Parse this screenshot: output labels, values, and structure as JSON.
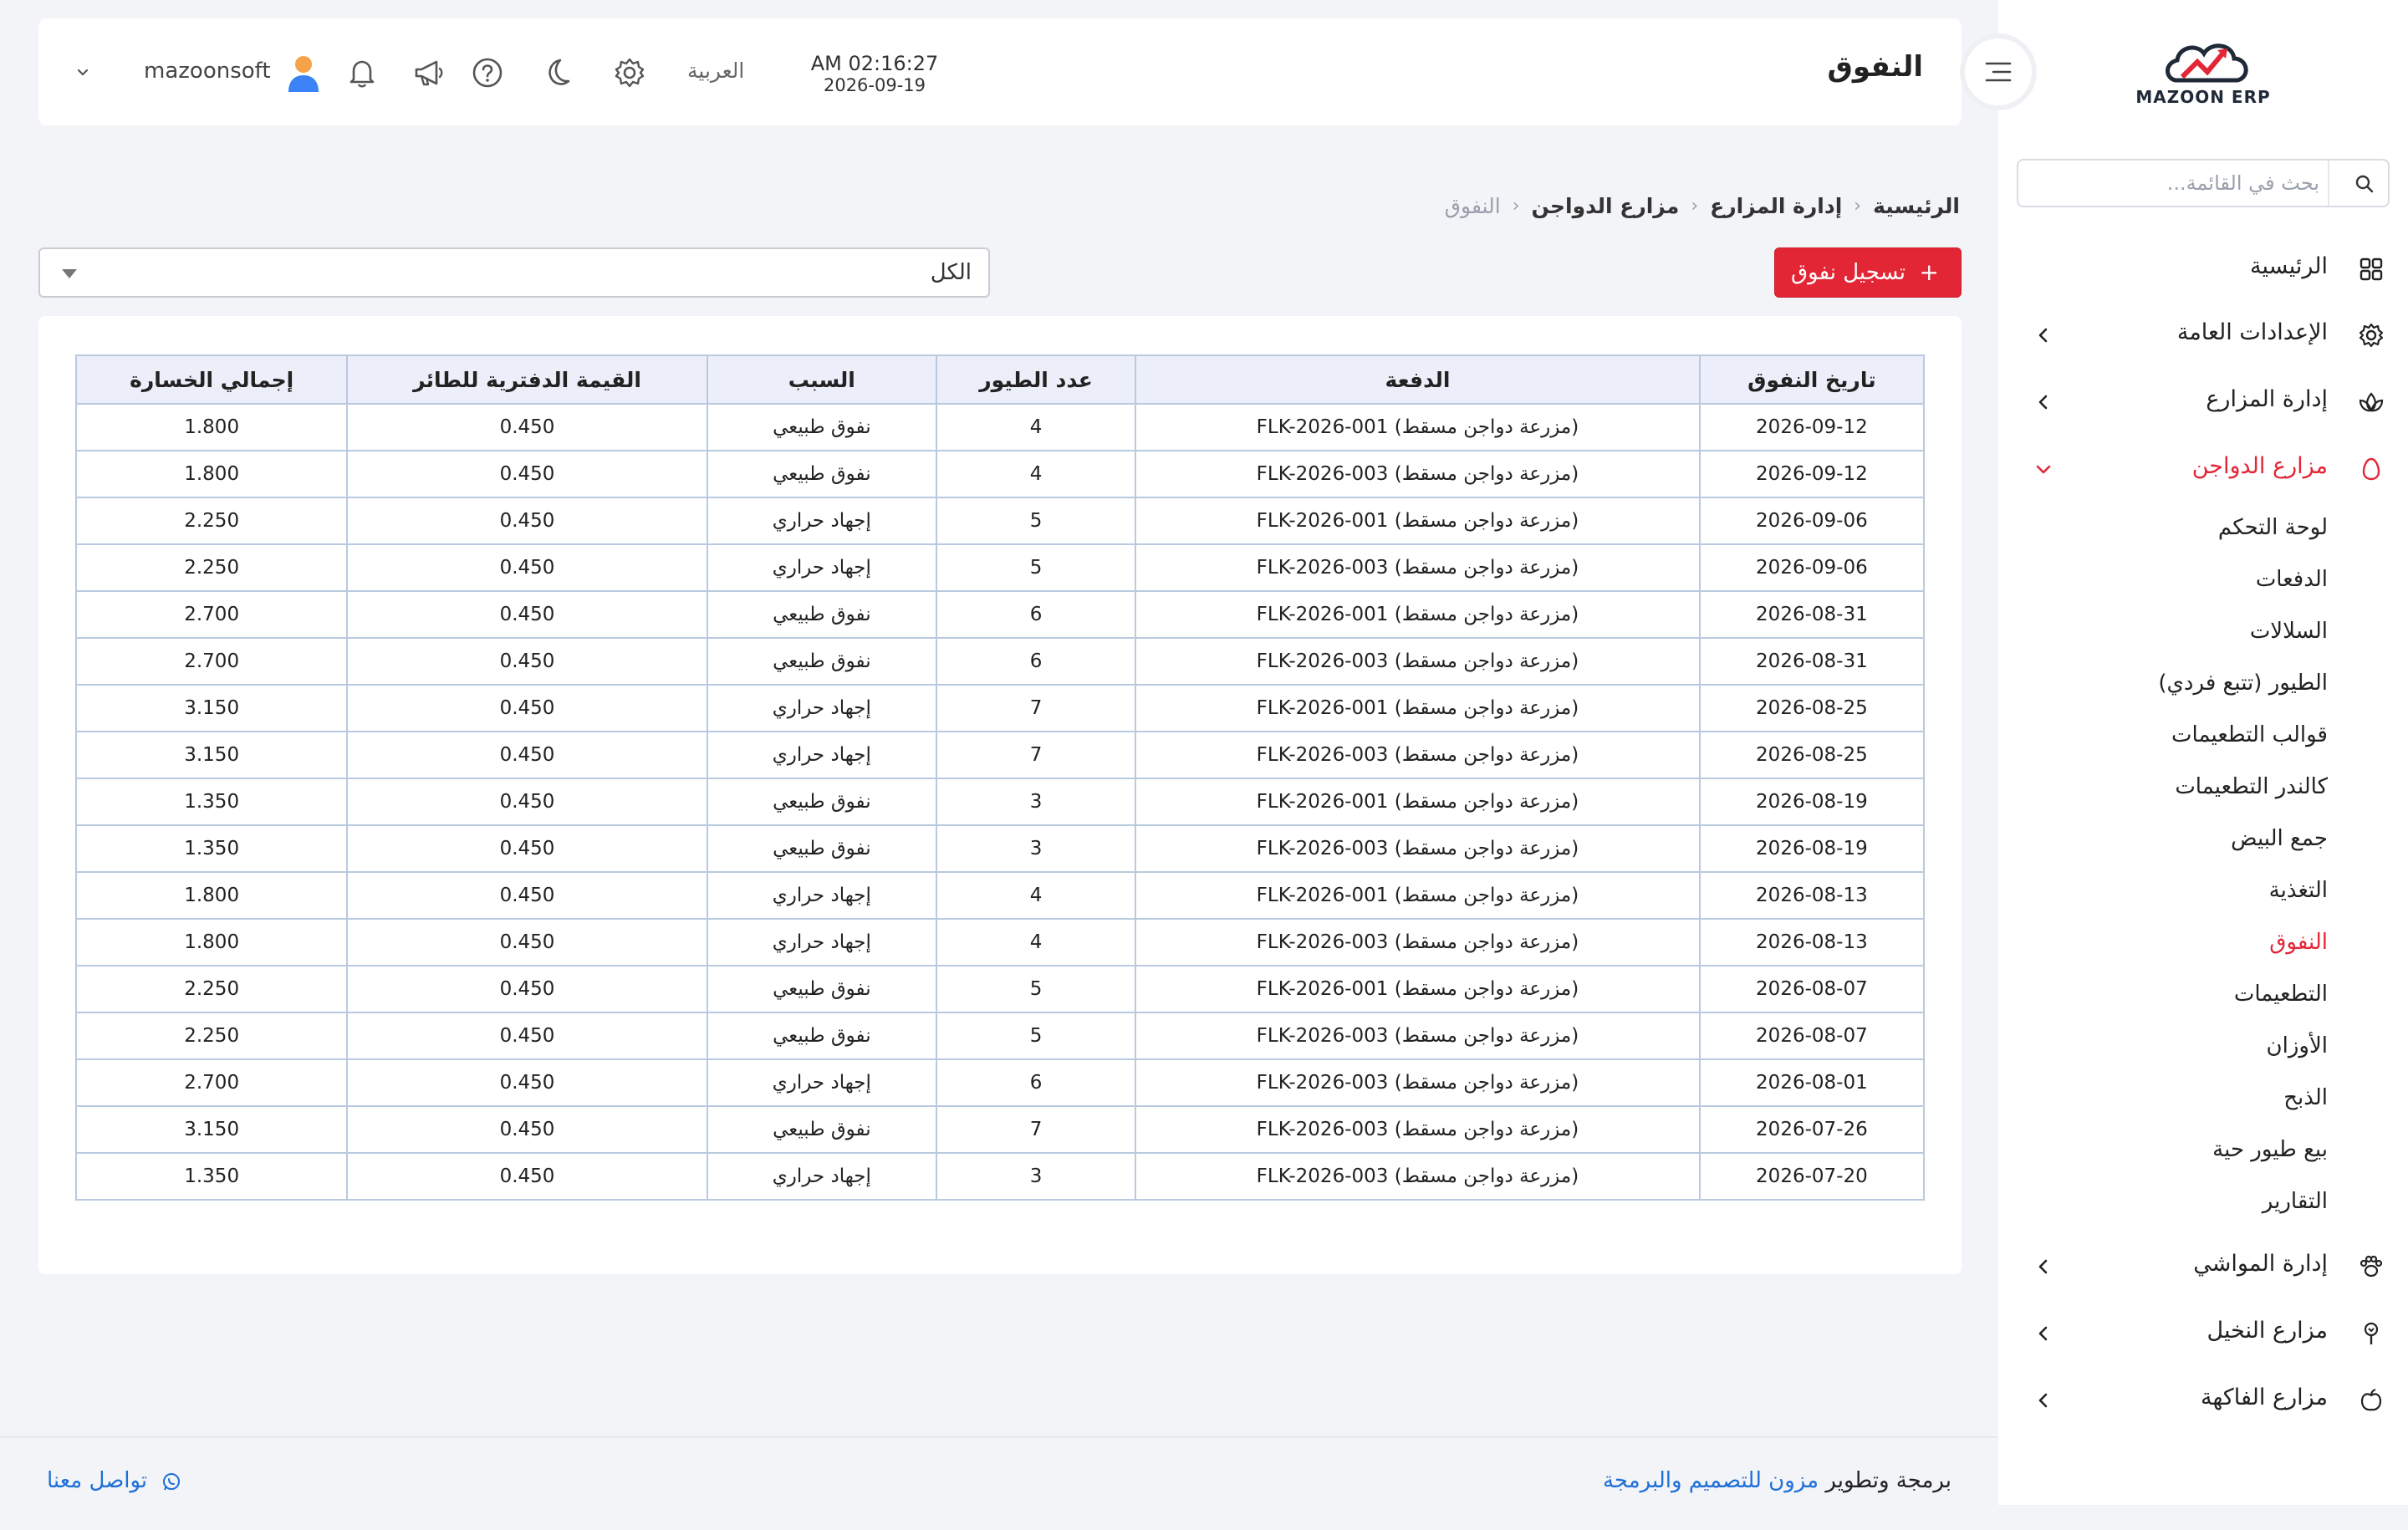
{
  "sidebar": {
    "logo_text": "MAZOON ERP",
    "search_placeholder": "بحث في القائمة...",
    "items": [
      {
        "label": "الرئيسية",
        "icon": "grid-icon"
      },
      {
        "label": "الإعدادات العامة",
        "icon": "gear-icon"
      },
      {
        "label": "إدارة المزارع",
        "icon": "plant-icon"
      },
      {
        "label": "مزارع الدواجن",
        "icon": "egg-icon"
      },
      {
        "label": "إدارة المواشي",
        "icon": "paw-icon"
      },
      {
        "label": "مزارع النخيل",
        "icon": "palm-icon"
      },
      {
        "label": "مزارع الفاكهة",
        "icon": "apple-icon"
      }
    ],
    "sub_items": [
      "لوحة التحكم",
      "الدفعات",
      "السلالات",
      "الطيور (تتبع فردي)",
      "قوالب التطعيمات",
      "كالندر التطعيمات",
      "جمع البيض",
      "التغذية",
      "النفوق",
      "التطعيمات",
      "الأوزان",
      "الذبح",
      "بيع طيور حية",
      "التقارير"
    ]
  },
  "header": {
    "title": "النفوق",
    "time": "AM 02:16:27",
    "date": "2026-09-19",
    "language": "العربية",
    "username": "mazoonsoft"
  },
  "breadcrumb": [
    "الرئيسية",
    "إدارة المزارع",
    "مزارع الدواجن",
    "النفوق"
  ],
  "toolbar": {
    "add_label": "تسجيل نفوق",
    "add_icon": "+",
    "filter_value": "الكل"
  },
  "table": {
    "headers": [
      "تاريخ النفوق",
      "الدفعة",
      "عدد الطيور",
      "السبب",
      "القيمة الدفترية للطائر",
      "إجمالي الخسارة"
    ],
    "rows": [
      [
        "2026-09-12",
        "FLK-2026-001 (مزرعة دواجن مسقط)",
        "4",
        "نفوق طبيعي",
        "0.450",
        "1.800"
      ],
      [
        "2026-09-12",
        "FLK-2026-003 (مزرعة دواجن مسقط)",
        "4",
        "نفوق طبيعي",
        "0.450",
        "1.800"
      ],
      [
        "2026-09-06",
        "FLK-2026-001 (مزرعة دواجن مسقط)",
        "5",
        "إجهاد حراري",
        "0.450",
        "2.250"
      ],
      [
        "2026-09-06",
        "FLK-2026-003 (مزرعة دواجن مسقط)",
        "5",
        "إجهاد حراري",
        "0.450",
        "2.250"
      ],
      [
        "2026-08-31",
        "FLK-2026-001 (مزرعة دواجن مسقط)",
        "6",
        "نفوق طبيعي",
        "0.450",
        "2.700"
      ],
      [
        "2026-08-31",
        "FLK-2026-003 (مزرعة دواجن مسقط)",
        "6",
        "نفوق طبيعي",
        "0.450",
        "2.700"
      ],
      [
        "2026-08-25",
        "FLK-2026-001 (مزرعة دواجن مسقط)",
        "7",
        "إجهاد حراري",
        "0.450",
        "3.150"
      ],
      [
        "2026-08-25",
        "FLK-2026-003 (مزرعة دواجن مسقط)",
        "7",
        "إجهاد حراري",
        "0.450",
        "3.150"
      ],
      [
        "2026-08-19",
        "FLK-2026-001 (مزرعة دواجن مسقط)",
        "3",
        "نفوق طبيعي",
        "0.450",
        "1.350"
      ],
      [
        "2026-08-19",
        "FLK-2026-003 (مزرعة دواجن مسقط)",
        "3",
        "نفوق طبيعي",
        "0.450",
        "1.350"
      ],
      [
        "2026-08-13",
        "FLK-2026-001 (مزرعة دواجن مسقط)",
        "4",
        "إجهاد حراري",
        "0.450",
        "1.800"
      ],
      [
        "2026-08-13",
        "FLK-2026-003 (مزرعة دواجن مسقط)",
        "4",
        "إجهاد حراري",
        "0.450",
        "1.800"
      ],
      [
        "2026-08-07",
        "FLK-2026-001 (مزرعة دواجن مسقط)",
        "5",
        "نفوق طبيعي",
        "0.450",
        "2.250"
      ],
      [
        "2026-08-07",
        "FLK-2026-003 (مزرعة دواجن مسقط)",
        "5",
        "نفوق طبيعي",
        "0.450",
        "2.250"
      ],
      [
        "2026-08-01",
        "FLK-2026-003 (مزرعة دواجن مسقط)",
        "6",
        "إجهاد حراري",
        "0.450",
        "2.700"
      ],
      [
        "2026-07-26",
        "FLK-2026-003 (مزرعة دواجن مسقط)",
        "7",
        "نفوق طبيعي",
        "0.450",
        "3.150"
      ],
      [
        "2026-07-20",
        "FLK-2026-003 (مزرعة دواجن مسقط)",
        "3",
        "إجهاد حراري",
        "0.450",
        "1.350"
      ]
    ]
  },
  "footer": {
    "prefix": "برمجة وتطوير",
    "company": "مزون للتصميم والبرمجة",
    "contact": "تواصل معنا"
  },
  "colors": {
    "accent": "#e32636",
    "link": "#1e6fd9",
    "table_header_bg": "#eceef9",
    "table_border": "#b9c9e0"
  }
}
